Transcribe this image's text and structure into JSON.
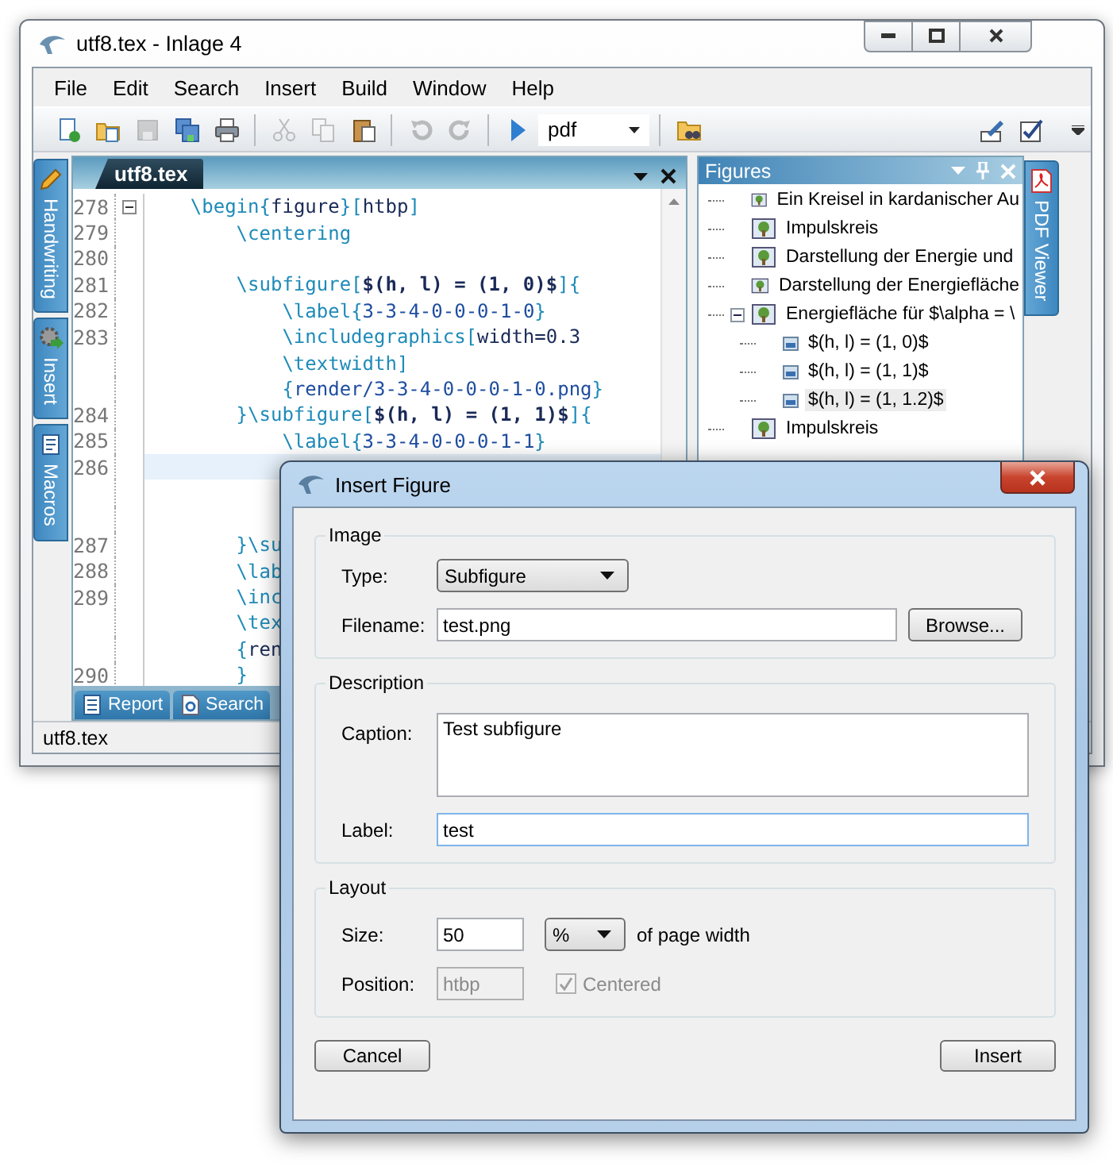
{
  "main_window": {
    "title": "utf8.tex - Inlage 4",
    "menu": [
      "File",
      "Edit",
      "Search",
      "Insert",
      "Build",
      "Window",
      "Help"
    ],
    "toolbar": {
      "left": [
        {
          "kind": "button",
          "disabled": false
        },
        {
          "kind": "button",
          "disabled": false
        },
        {
          "kind": "button",
          "disabled": true
        },
        {
          "kind": "button",
          "disabled": false
        },
        {
          "kind": "button",
          "disabled": false
        },
        {
          "kind": "separator"
        },
        {
          "kind": "button",
          "disabled": true
        },
        {
          "kind": "button",
          "disabled": true
        },
        {
          "kind": "button",
          "disabled": false
        },
        {
          "kind": "separator"
        },
        {
          "kind": "button",
          "disabled": true
        },
        {
          "kind": "button",
          "disabled": true
        },
        {
          "kind": "separator"
        },
        {
          "kind": "button",
          "disabled": false
        },
        {
          "kind": "dropdown",
          "value": "pdf"
        },
        {
          "kind": "separator"
        },
        {
          "kind": "button",
          "disabled": false
        }
      ],
      "right": [
        {
          "kind": "button",
          "disabled": false
        },
        {
          "kind": "button",
          "disabled": false
        }
      ]
    },
    "side_tabs": [
      "Handwriting",
      "Insert",
      "Macros"
    ],
    "editor": {
      "tab": "utf8.tex",
      "lines": [
        {
          "kind": "line",
          "number": "278",
          "current": false,
          "collapsed": false,
          "text": "    \\begin{figure}[htbp]"
        },
        {
          "kind": "line",
          "number": "279",
          "current": false,
          "text": "        \\centering"
        },
        {
          "kind": "line",
          "number": "280",
          "current": false
        },
        {
          "kind": "line",
          "number": "281",
          "current": false,
          "text": "        \\subfigure[$(h, l) = (1, 0)$]{"
        },
        {
          "kind": "line",
          "number": "282",
          "current": false,
          "text": "            \\label{3-3-4-0-0-0-1-0}"
        },
        {
          "kind": "line",
          "number": "283",
          "current": false,
          "text": "            \\includegraphics[width=0.3"
        },
        {
          "kind": "wrap",
          "text": "            \\textwidth]"
        },
        {
          "kind": "wrap",
          "text": "            {render/3-3-4-0-0-0-1-0.png}"
        },
        {
          "kind": "line",
          "number": "284",
          "current": false,
          "text": "        }\\subfigure[$(h, l) = (1, 1)$]{"
        },
        {
          "kind": "line",
          "number": "285",
          "current": false,
          "text": "            \\label{3-3-4-0-0-0-1-1}"
        },
        {
          "kind": "line",
          "number": "286",
          "current": true
        },
        {
          "kind": "wrap"
        },
        {
          "kind": "wrap"
        },
        {
          "kind": "line",
          "number": "287",
          "current": false,
          "text": "        }\\su"
        },
        {
          "kind": "line",
          "number": "288",
          "current": false,
          "text": "        \\lab"
        },
        {
          "kind": "line",
          "number": "289",
          "current": false,
          "text": "        \\inc"
        },
        {
          "kind": "wrap",
          "text": "        \\tex"
        },
        {
          "kind": "wrap",
          "text": "        {ren"
        },
        {
          "kind": "line",
          "number": "290",
          "current": false,
          "text": "        }"
        }
      ],
      "bottom_tabs": [
        "Report",
        "Search"
      ]
    },
    "figures": {
      "title": "Figures",
      "items": [
        {
          "label": "Ein Kreisel in kardanischer Au",
          "selected": false
        },
        {
          "label": "Impulskreis",
          "selected": false
        },
        {
          "label": "Darstellung der Energie und",
          "selected": false
        },
        {
          "label": "Darstellung der Energiefläche",
          "selected": false
        },
        {
          "label": "Energiefläche für $\\alpha = \\",
          "selected": false,
          "expanded": true,
          "children": [
            {
              "label": "$(h, l) = (1, 0)$",
              "selected": false
            },
            {
              "label": "$(h, l) = (1, 1)$",
              "selected": false
            },
            {
              "label": "$(h, l) = (1, 1.2)$",
              "selected": true
            }
          ]
        },
        {
          "label": "Impulskreis",
          "selected": false
        }
      ]
    },
    "pdf_tab": "PDF Viewer",
    "status_bar": "utf8.tex"
  },
  "dialog": {
    "title": "Insert Figure",
    "image": {
      "legend": "Image",
      "type_label": "Type:",
      "type_value": "Subfigure",
      "filename_label": "Filename:",
      "filename_value": "test.png",
      "browse": "Browse..."
    },
    "description": {
      "legend": "Description",
      "caption_label": "Caption:",
      "caption_value": "Test subfigure",
      "label_label": "Label:",
      "label_value": "test",
      "label_focused": true
    },
    "layout": {
      "legend": "Layout",
      "size_label": "Size:",
      "size_value": "50",
      "unit_value": "%",
      "unit_suffix": "of page width",
      "position_label": "Position:",
      "position_value": "htbp",
      "position_disabled": true,
      "centered_label": "Centered",
      "centered_checked": true,
      "centered_disabled": true
    },
    "buttons": {
      "cancel": "Cancel",
      "insert": "Insert"
    }
  }
}
